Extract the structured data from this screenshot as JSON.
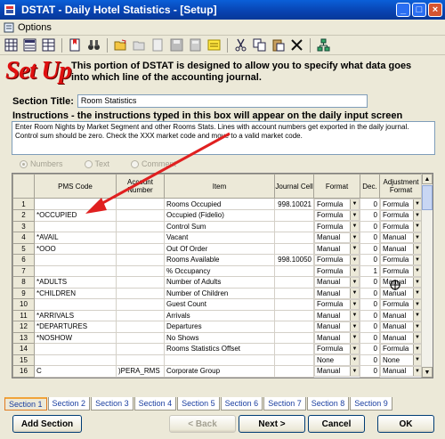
{
  "window": {
    "title": "DSTAT - Daily Hotel Statistics - [Setup]",
    "menu": [
      "Options"
    ]
  },
  "toolbar": {
    "icons": [
      "grid-icon",
      "list-icon",
      "table-icon",
      "bookmark-icon",
      "binoculars-icon",
      "open-folder-icon",
      "folder-icon",
      "print-preview-icon",
      "save-icon",
      "calculator-icon",
      "note-icon",
      "cut-icon",
      "copy-icon",
      "paste-icon",
      "delete-icon",
      "network-icon"
    ]
  },
  "header": {
    "logo_text": "Set Up",
    "intro": "This portion of DSTAT is designed to allow you to specify what data goes into which line of the accounting journal."
  },
  "section_title": {
    "label": "Section Title:",
    "value": "Room Statistics"
  },
  "instructions": {
    "label": "Instructions - the instructions typed in this box will appear on the daily input screen",
    "text": "Enter Room Nights by Market Segment and other Rooms Stats.  Lines with account numbers get exported in the daily journal. Control sum should be zero.  Check the XXX market code and move to a valid market code."
  },
  "radios": [
    {
      "label": "Numbers",
      "selected": true
    },
    {
      "label": "Text",
      "selected": false
    },
    {
      "label": "Comment",
      "selected": false
    }
  ],
  "grid": {
    "columns": [
      "",
      "PMS Code",
      "Account Number",
      "Item",
      "Journal Cell",
      "Format",
      "Dec.",
      "Adjustment Format"
    ],
    "rows": [
      {
        "n": "1",
        "pms": "",
        "acct": "",
        "item": "Rooms Occupied",
        "cell": "998.10021",
        "format": "Formula",
        "dec": "0",
        "adj": "Formula"
      },
      {
        "n": "2",
        "pms": "*OCCUPIED",
        "acct": "",
        "item": "Occupied (Fidelio)",
        "cell": "",
        "format": "Formula",
        "dec": "0",
        "adj": "Formula"
      },
      {
        "n": "3",
        "pms": "",
        "acct": "",
        "item": "Control Sum",
        "cell": "",
        "format": "Formula",
        "dec": "0",
        "adj": "Formula"
      },
      {
        "n": "4",
        "pms": "*AVAIL",
        "acct": "",
        "item": "Vacant",
        "cell": "",
        "format": "Manual",
        "dec": "0",
        "adj": "Manual"
      },
      {
        "n": "5",
        "pms": "*OOO",
        "acct": "",
        "item": "Out Of Order",
        "cell": "",
        "format": "Manual",
        "dec": "0",
        "adj": "Manual"
      },
      {
        "n": "6",
        "pms": "",
        "acct": "",
        "item": "Rooms Available",
        "cell": "998.10050",
        "format": "Formula",
        "dec": "0",
        "adj": "Formula"
      },
      {
        "n": "7",
        "pms": "",
        "acct": "",
        "item": "% Occupancy",
        "cell": "",
        "format": "Formula",
        "dec": "1",
        "adj": "Formula"
      },
      {
        "n": "8",
        "pms": "*ADULTS",
        "acct": "",
        "item": "Number of Adults",
        "cell": "",
        "format": "Manual",
        "dec": "0",
        "adj": "Manual"
      },
      {
        "n": "9",
        "pms": "*CHILDREN",
        "acct": "",
        "item": "Number of Children",
        "cell": "",
        "format": "Manual",
        "dec": "0",
        "adj": "Manual"
      },
      {
        "n": "10",
        "pms": "",
        "acct": "",
        "item": "Guest Count",
        "cell": "",
        "format": "Formula",
        "dec": "0",
        "adj": "Formula"
      },
      {
        "n": "11",
        "pms": "*ARRIVALS",
        "acct": "",
        "item": "Arrivals",
        "cell": "",
        "format": "Manual",
        "dec": "0",
        "adj": "Manual"
      },
      {
        "n": "12",
        "pms": "*DEPARTURES",
        "acct": "",
        "item": "Departures",
        "cell": "",
        "format": "Manual",
        "dec": "0",
        "adj": "Manual"
      },
      {
        "n": "13",
        "pms": "*NOSHOW",
        "acct": "",
        "item": "No Shows",
        "cell": "",
        "format": "Manual",
        "dec": "0",
        "adj": "Manual"
      },
      {
        "n": "14",
        "pms": "",
        "acct": "",
        "item": "Rooms Statistics Offset",
        "cell": "",
        "format": "Formula",
        "dec": "0",
        "adj": "Formula"
      },
      {
        "n": "15",
        "pms": "",
        "acct": "",
        "item": "",
        "cell": "",
        "format": "None",
        "dec": "0",
        "adj": "None"
      },
      {
        "n": "16",
        "pms": "C",
        "acct": ")PERA_RMS",
        "item": "Corporate Group",
        "cell": "",
        "format": "Manual",
        "dec": "0",
        "adj": "Manual"
      }
    ]
  },
  "tabs": [
    "Section 1",
    "Section 2",
    "Section 3",
    "Section 4",
    "Section 5",
    "Section 6",
    "Section 7",
    "Section 8",
    "Section 9"
  ],
  "buttons": {
    "add_section": "Add Section",
    "back": "< Back",
    "next": "Next >",
    "cancel": "Cancel",
    "ok": "OK"
  },
  "colors": {
    "title_bar": "#0842b0",
    "logo": "#e01010",
    "arrow": "#e02020",
    "tab_text": "#1b3fa0"
  }
}
